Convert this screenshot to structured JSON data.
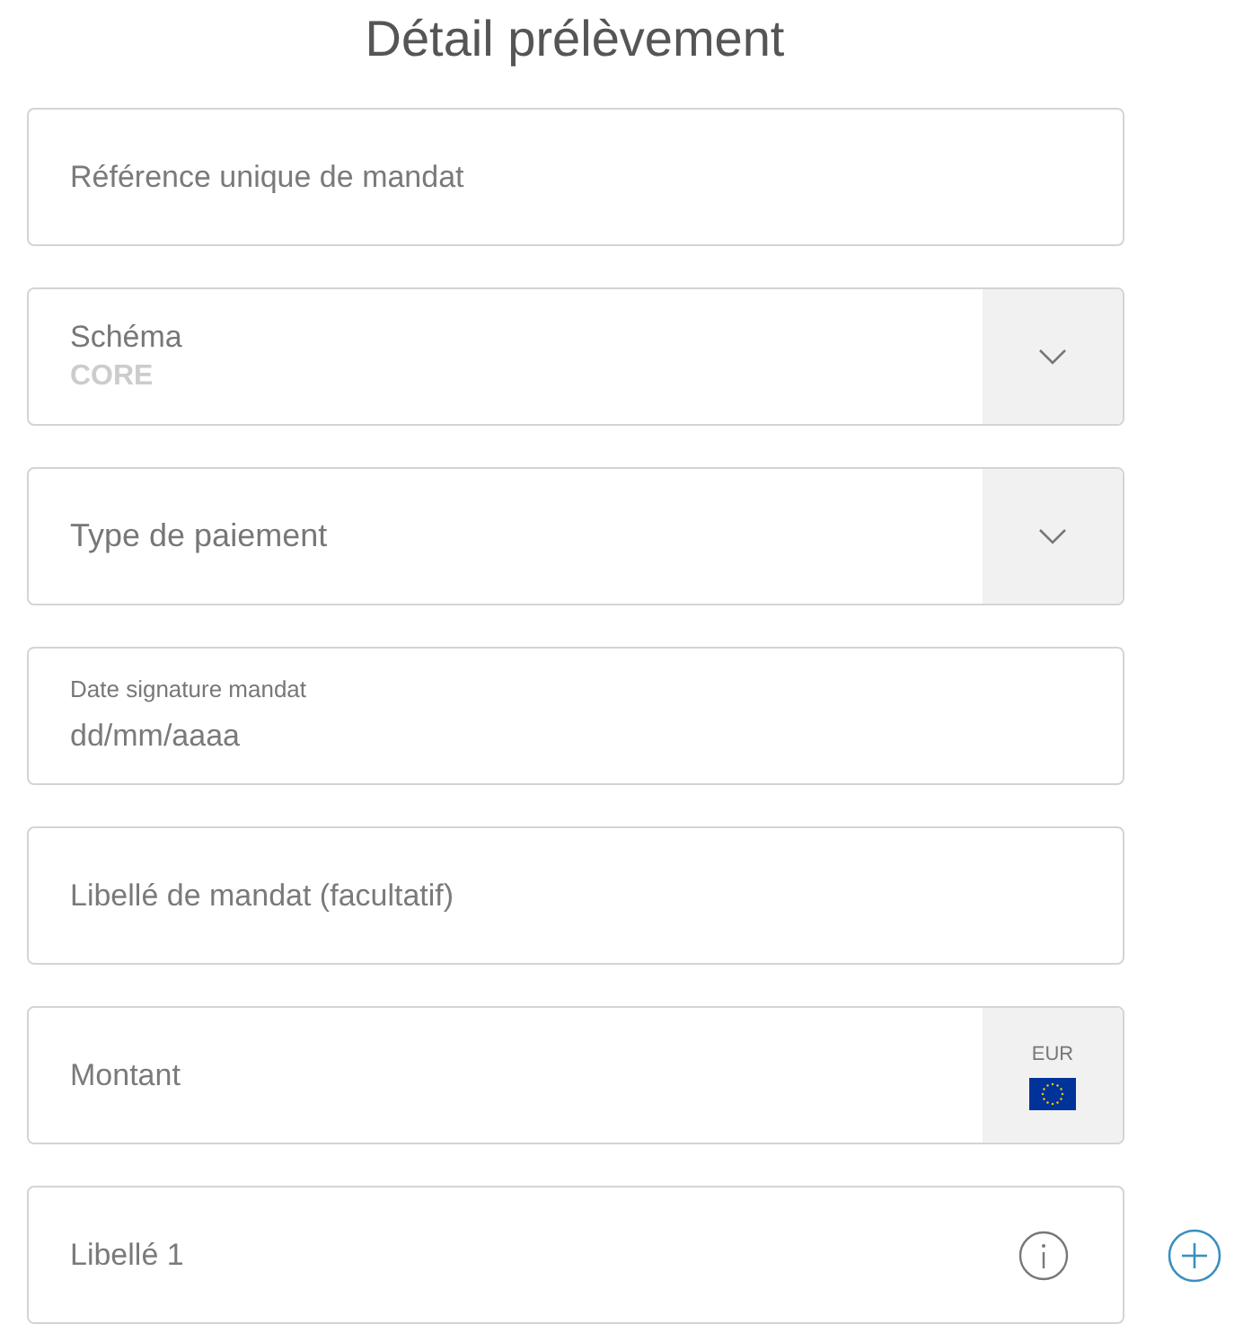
{
  "title": "Détail prélèvement",
  "fields": [
    {
      "kind": "text",
      "placeholder": "Référence unique de mandat"
    },
    {
      "kind": "select",
      "label": "Schéma",
      "value": "CORE"
    },
    {
      "kind": "select",
      "placeholder": "Type de paiement"
    },
    {
      "kind": "date",
      "label": "Date signature mandat",
      "placeholder": "dd/mm/aaaa"
    },
    {
      "kind": "text",
      "placeholder": "Libellé de mandat (facultatif)"
    },
    {
      "kind": "currency",
      "placeholder": "Montant",
      "currency": "EUR"
    },
    {
      "kind": "info",
      "placeholder": "Libellé 1",
      "add_button": true
    }
  ]
}
